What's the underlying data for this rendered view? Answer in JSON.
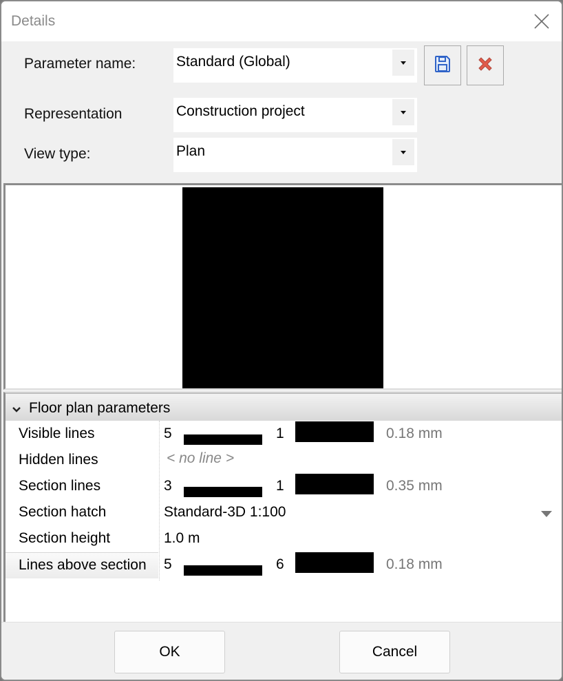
{
  "window": {
    "title": "Details"
  },
  "form": {
    "parameter_name": {
      "label": "Parameter name:",
      "value": "Standard (Global)"
    },
    "representation": {
      "label": "Representation",
      "value": "Construction project"
    },
    "view_type": {
      "label": "View type:",
      "value": "Plan"
    }
  },
  "toolbar": {
    "save_icon": "save-icon",
    "delete_icon": "delete-icon"
  },
  "properties": {
    "group_title": "Floor plan parameters",
    "rows": [
      {
        "name": "Visible lines",
        "pen": "5",
        "line_type": "1",
        "thickness": "0.18 mm"
      },
      {
        "name": "Hidden lines",
        "text": "< no line >"
      },
      {
        "name": "Section lines",
        "pen": "3",
        "line_type": "1",
        "thickness": "0.35 mm"
      },
      {
        "name": "Section hatch",
        "text": "Standard-3D 1:100"
      },
      {
        "name": "Section height",
        "text": "1.0 m"
      },
      {
        "name": "Lines above section",
        "pen": "5",
        "line_type": "6",
        "thickness": "0.18 mm"
      }
    ]
  },
  "footer": {
    "ok_label": "OK",
    "cancel_label": "Cancel"
  }
}
